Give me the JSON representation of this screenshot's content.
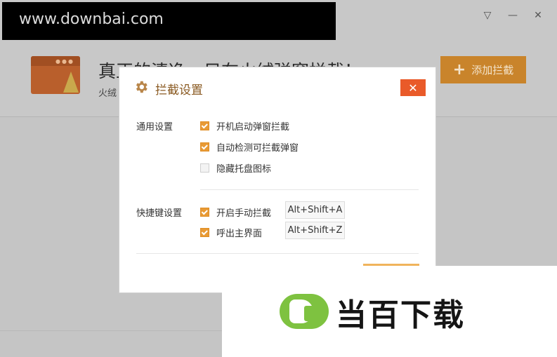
{
  "app": {
    "title": "真正的清净，只在火绒弹窗拦截！",
    "subtitle": "火绒",
    "add_button_label": "添加拦截",
    "window_controls": [
      "▽",
      "—",
      "✕"
    ]
  },
  "watermarks": {
    "top_text": "www.downbai.com",
    "bottom_text": "当百下载"
  },
  "dialog": {
    "title": "拦截设置",
    "close_glyph": "✕",
    "general": {
      "label": "通用设置",
      "options": [
        {
          "label": "开机启动弹窗拦截",
          "checked": true
        },
        {
          "label": "自动检测可拦截弹窗",
          "checked": true
        },
        {
          "label": "隐藏托盘图标",
          "checked": false
        }
      ]
    },
    "hotkeys": {
      "label": "快捷键设置",
      "options": [
        {
          "label": "开启手动拦截",
          "checked": true,
          "key": "Alt+Shift+A"
        },
        {
          "label": "呼出主界面",
          "checked": true,
          "key": "Alt+Shift+Z"
        }
      ]
    }
  },
  "colors": {
    "accent": "#e89a35",
    "close_button": "#e95a29",
    "watermark_green": "#7ec240"
  },
  "icons": [
    "gear-icon",
    "close-icon",
    "plus-icon",
    "minimize-icon",
    "menu-icon",
    "app-logo-icon"
  ]
}
